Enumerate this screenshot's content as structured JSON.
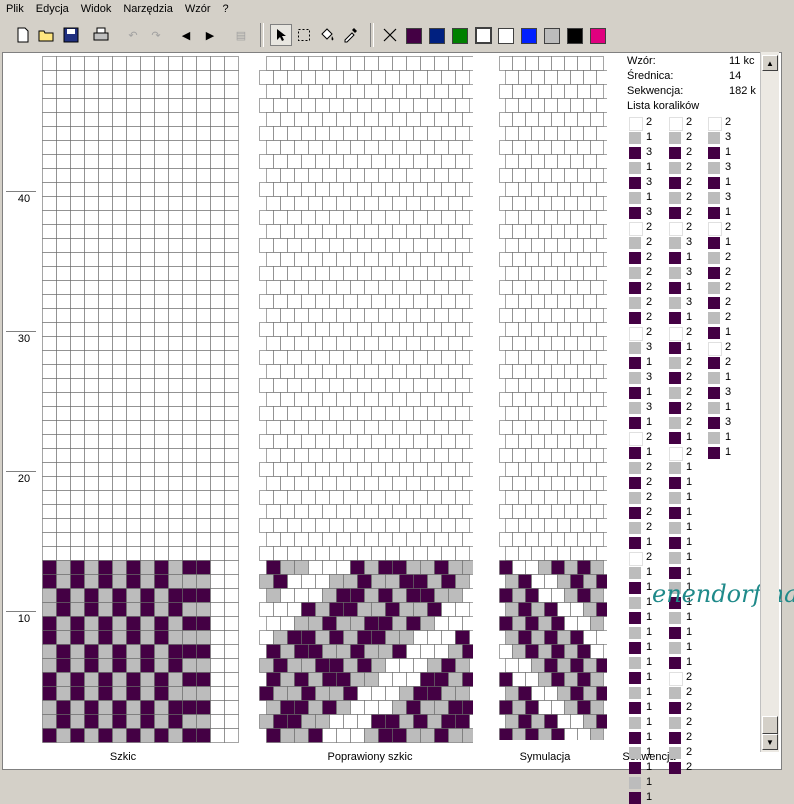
{
  "menu": [
    "Plik",
    "Edycja",
    "Widok",
    "Narzędzia",
    "Wzór",
    "?"
  ],
  "toolbar": {
    "icons": [
      "new-file-icon",
      "open-folder-icon",
      "save-icon",
      "print-icon",
      "undo-icon",
      "redo-icon",
      "arrow-left-icon",
      "arrow-right-icon",
      "paste-icon",
      "pointer-icon",
      "select-rect-icon",
      "fill-icon",
      "eyedropper-icon",
      "delete-icon"
    ],
    "colors": [
      "#440044",
      "#002080",
      "#008000",
      "#ffffff",
      "#ffffff",
      "#0020ff",
      "#bcbcbc",
      "#000000",
      "#e0007f"
    ]
  },
  "row_labels": [
    "40",
    "30",
    "20",
    "10"
  ],
  "panels": {
    "sketch_label": "Szkic",
    "corrected_label": "Poprawiony szkic",
    "simulation_label": "Symulacja",
    "sequence_label": "Sekwencja"
  },
  "info": {
    "pattern_key": "Wzór:",
    "pattern_val": "11 kc",
    "diameter_key": "Średnica:",
    "diameter_val": "14",
    "sequence_key": "Sekwencja:",
    "sequence_val": "182 k",
    "list_title": "Lista koralików"
  },
  "bead_colors": {
    "D": "#440044",
    "G": "#bcbcbc",
    "W": "#ffffff"
  },
  "bead_list": [
    [
      [
        "W",
        2
      ],
      [
        "G",
        1
      ],
      [
        "D",
        3
      ],
      [
        "G",
        1
      ],
      [
        "D",
        3
      ],
      [
        "G",
        1
      ],
      [
        "D",
        3
      ],
      [
        "W",
        2
      ],
      [
        "G",
        2
      ],
      [
        "D",
        2
      ],
      [
        "G",
        2
      ],
      [
        "D",
        2
      ],
      [
        "G",
        2
      ],
      [
        "D",
        2
      ],
      [
        "W",
        2
      ],
      [
        "G",
        3
      ],
      [
        "D",
        1
      ],
      [
        "G",
        3
      ],
      [
        "D",
        1
      ],
      [
        "G",
        3
      ],
      [
        "D",
        1
      ],
      [
        "W",
        2
      ],
      [
        "D",
        1
      ],
      [
        "G",
        2
      ],
      [
        "D",
        2
      ],
      [
        "G",
        2
      ],
      [
        "D",
        2
      ],
      [
        "G",
        2
      ],
      [
        "D",
        1
      ],
      [
        "W",
        2
      ],
      [
        "G",
        1
      ],
      [
        "D",
        1
      ],
      [
        "G",
        1
      ],
      [
        "D",
        1
      ],
      [
        "G",
        1
      ],
      [
        "D",
        1
      ],
      [
        "G",
        1
      ],
      [
        "D",
        1
      ],
      [
        "G",
        1
      ],
      [
        "D",
        1
      ],
      [
        "G",
        1
      ],
      [
        "D",
        1
      ],
      [
        "G",
        1
      ],
      [
        "D",
        1
      ],
      [
        "G",
        1
      ],
      [
        "D",
        1
      ]
    ],
    [
      [
        "W",
        2
      ],
      [
        "G",
        2
      ],
      [
        "D",
        2
      ],
      [
        "G",
        2
      ],
      [
        "D",
        2
      ],
      [
        "G",
        2
      ],
      [
        "D",
        2
      ],
      [
        "W",
        2
      ],
      [
        "G",
        3
      ],
      [
        "D",
        1
      ],
      [
        "G",
        3
      ],
      [
        "D",
        1
      ],
      [
        "G",
        3
      ],
      [
        "D",
        1
      ],
      [
        "W",
        2
      ],
      [
        "D",
        1
      ],
      [
        "G",
        2
      ],
      [
        "D",
        2
      ],
      [
        "G",
        2
      ],
      [
        "D",
        2
      ],
      [
        "G",
        2
      ],
      [
        "D",
        1
      ],
      [
        "W",
        2
      ],
      [
        "G",
        1
      ],
      [
        "D",
        1
      ],
      [
        "G",
        1
      ],
      [
        "D",
        1
      ],
      [
        "G",
        1
      ],
      [
        "D",
        1
      ],
      [
        "G",
        1
      ],
      [
        "D",
        1
      ],
      [
        "G",
        1
      ],
      [
        "D",
        1
      ],
      [
        "G",
        1
      ],
      [
        "D",
        1
      ],
      [
        "G",
        1
      ],
      [
        "D",
        1
      ],
      [
        "W",
        2
      ],
      [
        "G",
        2
      ],
      [
        "D",
        2
      ],
      [
        "G",
        2
      ],
      [
        "D",
        2
      ],
      [
        "G",
        2
      ],
      [
        "D",
        2
      ]
    ],
    [
      [
        "W",
        2
      ],
      [
        "G",
        3
      ],
      [
        "D",
        1
      ],
      [
        "G",
        3
      ],
      [
        "D",
        1
      ],
      [
        "G",
        3
      ],
      [
        "D",
        1
      ],
      [
        "W",
        2
      ],
      [
        "D",
        1
      ],
      [
        "G",
        2
      ],
      [
        "D",
        2
      ],
      [
        "G",
        2
      ],
      [
        "D",
        2
      ],
      [
        "G",
        2
      ],
      [
        "D",
        1
      ],
      [
        "W",
        2
      ],
      [
        "D",
        2
      ],
      [
        "G",
        1
      ],
      [
        "D",
        3
      ],
      [
        "G",
        1
      ],
      [
        "D",
        3
      ],
      [
        "G",
        1
      ],
      [
        "D",
        1
      ]
    ]
  ],
  "watermark": "enendorfina"
}
